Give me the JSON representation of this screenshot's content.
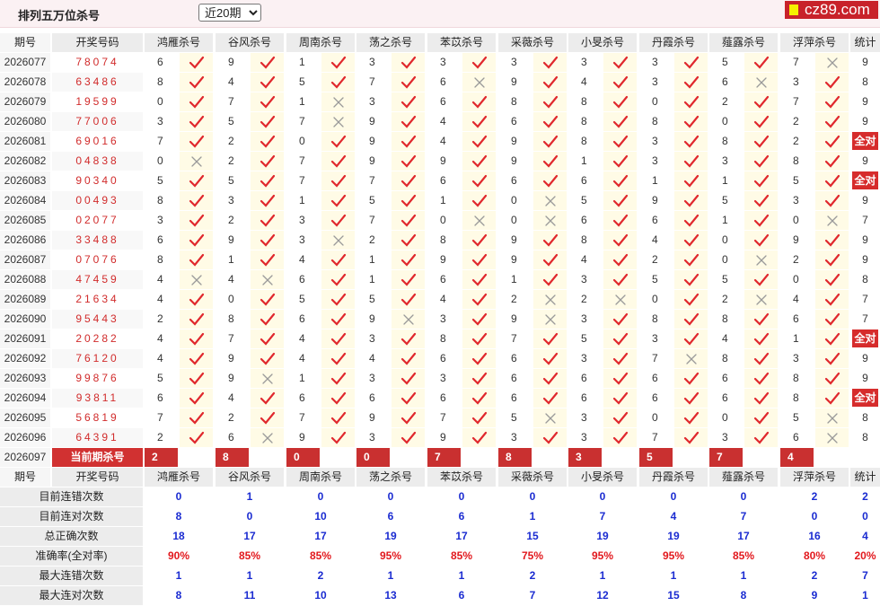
{
  "header": {
    "title": "排列五万位杀号",
    "period_select": "近20期",
    "brand": "cz89.com"
  },
  "columns": {
    "period": "期号",
    "code": "开奖号码",
    "count": "统计",
    "experts": [
      "鸿雁杀号",
      "谷风杀号",
      "周南杀号",
      "荡之杀号",
      "苯苡杀号",
      "采薇杀号",
      "小旻杀号",
      "丹霞杀号",
      "薤露杀号",
      "浮萍杀号"
    ]
  },
  "rows": [
    {
      "period": "2026077",
      "code": "78074",
      "kills": [
        "6",
        "9",
        "1",
        "3",
        "3",
        "3",
        "3",
        "3",
        "5",
        "7"
      ],
      "marks": [
        "right",
        "right",
        "right",
        "right",
        "right",
        "right",
        "right",
        "right",
        "right",
        "wrong"
      ],
      "count": "9"
    },
    {
      "period": "2026078",
      "code": "63486",
      "kills": [
        "8",
        "4",
        "5",
        "7",
        "6",
        "9",
        "4",
        "3",
        "6",
        "3"
      ],
      "marks": [
        "right",
        "right",
        "right",
        "right",
        "wrong",
        "right",
        "right",
        "right",
        "wrong",
        "right"
      ],
      "count": "8"
    },
    {
      "period": "2026079",
      "code": "19599",
      "kills": [
        "0",
        "7",
        "1",
        "3",
        "6",
        "8",
        "8",
        "0",
        "2",
        "7"
      ],
      "marks": [
        "right",
        "right",
        "wrong",
        "right",
        "right",
        "right",
        "right",
        "right",
        "right",
        "right"
      ],
      "count": "9"
    },
    {
      "period": "2026080",
      "code": "77006",
      "kills": [
        "3",
        "5",
        "7",
        "9",
        "4",
        "6",
        "8",
        "8",
        "0",
        "2"
      ],
      "marks": [
        "right",
        "right",
        "wrong",
        "right",
        "right",
        "right",
        "right",
        "right",
        "right",
        "right"
      ],
      "count": "9"
    },
    {
      "period": "2026081",
      "code": "69016",
      "kills": [
        "7",
        "2",
        "0",
        "9",
        "4",
        "9",
        "8",
        "3",
        "8",
        "2"
      ],
      "marks": [
        "right",
        "right",
        "right",
        "right",
        "right",
        "right",
        "right",
        "right",
        "right",
        "right"
      ],
      "count": "全对"
    },
    {
      "period": "2026082",
      "code": "04838",
      "kills": [
        "0",
        "2",
        "7",
        "9",
        "9",
        "9",
        "1",
        "3",
        "3",
        "8"
      ],
      "marks": [
        "wrong",
        "right",
        "right",
        "right",
        "right",
        "right",
        "right",
        "right",
        "right",
        "right"
      ],
      "count": "9"
    },
    {
      "period": "2026083",
      "code": "90340",
      "kills": [
        "5",
        "5",
        "7",
        "7",
        "6",
        "6",
        "6",
        "1",
        "1",
        "5"
      ],
      "marks": [
        "right",
        "right",
        "right",
        "right",
        "right",
        "right",
        "right",
        "right",
        "right",
        "right"
      ],
      "count": "全对"
    },
    {
      "period": "2026084",
      "code": "00493",
      "kills": [
        "8",
        "3",
        "1",
        "5",
        "1",
        "0",
        "5",
        "9",
        "5",
        "3"
      ],
      "marks": [
        "right",
        "right",
        "right",
        "right",
        "right",
        "wrong",
        "right",
        "right",
        "right",
        "right"
      ],
      "count": "9"
    },
    {
      "period": "2026085",
      "code": "02077",
      "kills": [
        "3",
        "2",
        "3",
        "7",
        "0",
        "0",
        "6",
        "6",
        "1",
        "0"
      ],
      "marks": [
        "right",
        "right",
        "right",
        "right",
        "wrong",
        "wrong",
        "right",
        "right",
        "right",
        "wrong"
      ],
      "count": "7"
    },
    {
      "period": "2026086",
      "code": "33488",
      "kills": [
        "6",
        "9",
        "3",
        "2",
        "8",
        "9",
        "8",
        "4",
        "0",
        "9"
      ],
      "marks": [
        "right",
        "right",
        "wrong",
        "right",
        "right",
        "right",
        "right",
        "right",
        "right",
        "right"
      ],
      "count": "9"
    },
    {
      "period": "2026087",
      "code": "07076",
      "kills": [
        "8",
        "1",
        "4",
        "1",
        "9",
        "9",
        "4",
        "2",
        "0",
        "2"
      ],
      "marks": [
        "right",
        "right",
        "right",
        "right",
        "right",
        "right",
        "right",
        "right",
        "wrong",
        "right"
      ],
      "count": "9"
    },
    {
      "period": "2026088",
      "code": "47459",
      "kills": [
        "4",
        "4",
        "6",
        "1",
        "6",
        "1",
        "3",
        "5",
        "5",
        "0"
      ],
      "marks": [
        "wrong",
        "wrong",
        "right",
        "right",
        "right",
        "right",
        "right",
        "right",
        "right",
        "right"
      ],
      "count": "8"
    },
    {
      "period": "2026089",
      "code": "21634",
      "kills": [
        "4",
        "0",
        "5",
        "5",
        "4",
        "2",
        "2",
        "0",
        "2",
        "4"
      ],
      "marks": [
        "right",
        "right",
        "right",
        "right",
        "right",
        "wrong",
        "wrong",
        "right",
        "wrong",
        "right"
      ],
      "count": "7"
    },
    {
      "period": "2026090",
      "code": "95443",
      "kills": [
        "2",
        "8",
        "6",
        "9",
        "3",
        "9",
        "3",
        "8",
        "8",
        "6"
      ],
      "marks": [
        "right",
        "right",
        "right",
        "wrong",
        "right",
        "wrong",
        "right",
        "right",
        "right",
        "right"
      ],
      "count": "7"
    },
    {
      "period": "2026091",
      "code": "20282",
      "kills": [
        "4",
        "7",
        "4",
        "3",
        "8",
        "7",
        "5",
        "3",
        "4",
        "1"
      ],
      "marks": [
        "right",
        "right",
        "right",
        "right",
        "right",
        "right",
        "right",
        "right",
        "right",
        "right"
      ],
      "count": "全对"
    },
    {
      "period": "2026092",
      "code": "76120",
      "kills": [
        "4",
        "9",
        "4",
        "4",
        "6",
        "6",
        "3",
        "7",
        "8",
        "3"
      ],
      "marks": [
        "right",
        "right",
        "right",
        "right",
        "right",
        "right",
        "right",
        "wrong",
        "right",
        "right"
      ],
      "count": "9"
    },
    {
      "period": "2026093",
      "code": "99876",
      "kills": [
        "5",
        "9",
        "1",
        "3",
        "3",
        "6",
        "6",
        "6",
        "6",
        "8"
      ],
      "marks": [
        "right",
        "wrong",
        "right",
        "right",
        "right",
        "right",
        "right",
        "right",
        "right",
        "right"
      ],
      "count": "9"
    },
    {
      "period": "2026094",
      "code": "93811",
      "kills": [
        "6",
        "4",
        "6",
        "6",
        "6",
        "6",
        "6",
        "6",
        "6",
        "8"
      ],
      "marks": [
        "right",
        "right",
        "right",
        "right",
        "right",
        "right",
        "right",
        "right",
        "right",
        "right"
      ],
      "count": "全对"
    },
    {
      "period": "2026095",
      "code": "56819",
      "kills": [
        "7",
        "2",
        "7",
        "9",
        "7",
        "5",
        "3",
        "0",
        "0",
        "5"
      ],
      "marks": [
        "right",
        "right",
        "right",
        "right",
        "right",
        "wrong",
        "right",
        "right",
        "right",
        "wrong"
      ],
      "count": "8"
    },
    {
      "period": "2026096",
      "code": "64391",
      "kills": [
        "2",
        "6",
        "9",
        "3",
        "9",
        "3",
        "3",
        "7",
        "3",
        "6"
      ],
      "marks": [
        "right",
        "wrong",
        "right",
        "right",
        "right",
        "right",
        "right",
        "right",
        "right",
        "wrong"
      ],
      "count": "8"
    }
  ],
  "current": {
    "period": "2026097",
    "label": "当前期杀号",
    "kills": [
      "2",
      "8",
      "0",
      "0",
      "7",
      "8",
      "3",
      "5",
      "7",
      "4"
    ]
  },
  "stats": [
    {
      "label": "目前连错次数",
      "values": [
        "0",
        "1",
        "0",
        "0",
        "0",
        "0",
        "0",
        "0",
        "0",
        "2"
      ],
      "last": "2",
      "red": false
    },
    {
      "label": "目前连对次数",
      "values": [
        "8",
        "0",
        "10",
        "6",
        "6",
        "1",
        "7",
        "4",
        "7",
        "0"
      ],
      "last": "0",
      "red": false
    },
    {
      "label": "总正确次数",
      "values": [
        "18",
        "17",
        "17",
        "19",
        "17",
        "15",
        "19",
        "19",
        "17",
        "16"
      ],
      "last": "4",
      "red": false
    },
    {
      "label": "准确率(全对率)",
      "values": [
        "90%",
        "85%",
        "85%",
        "95%",
        "85%",
        "75%",
        "95%",
        "95%",
        "85%",
        "80%"
      ],
      "last": "20%",
      "red": true
    },
    {
      "label": "最大连错次数",
      "values": [
        "1",
        "1",
        "2",
        "1",
        "1",
        "2",
        "1",
        "1",
        "1",
        "2"
      ],
      "last": "7",
      "red": false
    },
    {
      "label": "最大连对次数",
      "values": [
        "8",
        "11",
        "10",
        "13",
        "6",
        "7",
        "12",
        "15",
        "8",
        "9"
      ],
      "last": "1",
      "red": false
    }
  ],
  "colors": {
    "accent": "#d13131",
    "right_mark": "#e0282d",
    "wrong_mark": "#9a9a9a",
    "stat_blue": "#1a2bd1"
  }
}
